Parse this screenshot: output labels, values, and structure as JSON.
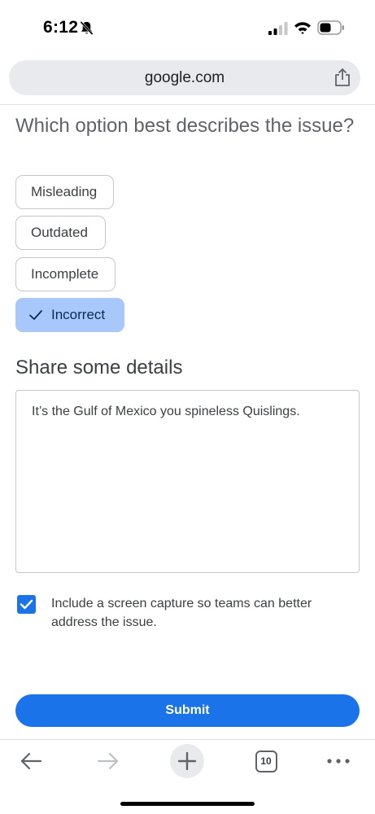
{
  "status_bar": {
    "time": "6:12",
    "icons": [
      "bell-slash-icon",
      "cellular-signal-icon",
      "wifi-icon",
      "battery-icon"
    ]
  },
  "browser": {
    "url": "google.com",
    "share_icon": "share-icon"
  },
  "form": {
    "question": "Which option best describes the issue?",
    "options": [
      {
        "label": "Misleading",
        "selected": false
      },
      {
        "label": "Outdated",
        "selected": false
      },
      {
        "label": "Incomplete",
        "selected": false
      },
      {
        "label": "Incorrect",
        "selected": true
      }
    ],
    "details_title": "Share some details",
    "details_value": "It’s the Gulf of Mexico you spineless Quislings.",
    "include_capture_checked": true,
    "include_capture_label": "Include a screen capture so teams can better address the issue.",
    "submit_label": "Submit"
  },
  "toolbar": {
    "tab_count": "10",
    "icons": [
      "back-arrow-icon",
      "forward-arrow-icon",
      "plus-icon",
      "tabs-icon",
      "more-icon"
    ]
  },
  "colors": {
    "accent": "#1a73e8",
    "selected_option": "#a8c7fa",
    "url_bar": "#e8eaed"
  }
}
